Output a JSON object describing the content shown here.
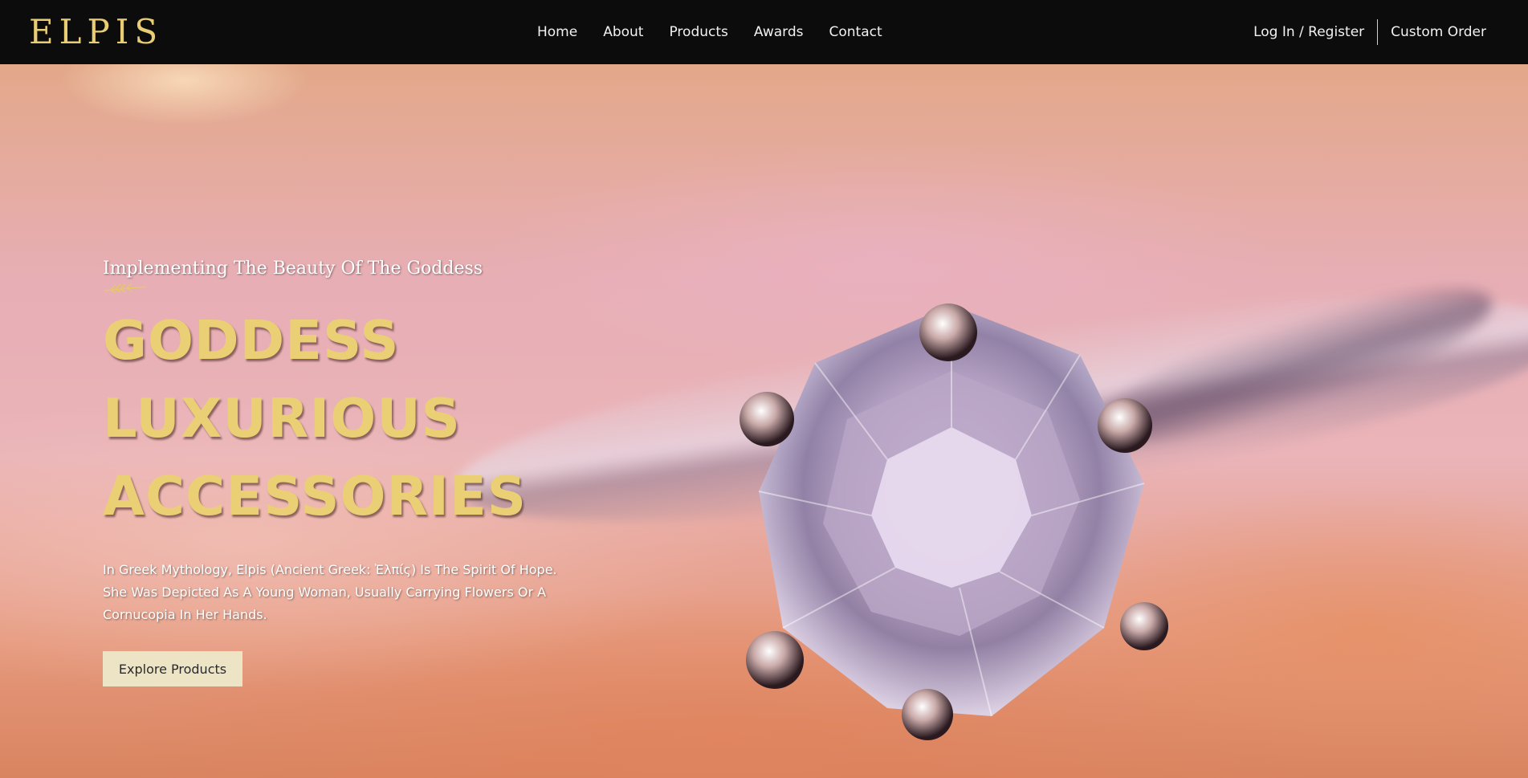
{
  "navbar": {
    "logo": "ELPIS",
    "links": [
      "Home",
      "About",
      "Products",
      "Awards",
      "Contact"
    ],
    "login_label": "Log In / Register",
    "custom_order_label": "Custom Order"
  },
  "hero": {
    "subtitle": "Implementing The Beauty Of The Goddess",
    "title_lines": [
      "GODDESS",
      "LUXURIOUS",
      "ACCESSORIES"
    ],
    "description": "In Greek Mythology, Elpis (Ancient Greek: Ἐλπίς) Is The Spirit Of Hope. She Was Depicted As A Young Woman, Usually Carrying Flowers Or A Cornucopia In Her Hands.",
    "button_label": "Explore Products",
    "background_image": "diamond-ring-photo"
  },
  "colors": {
    "accent_gold": "#ebcf75",
    "navbar_bg": "#0c0c0c",
    "button_bg": "#ede4c5"
  }
}
